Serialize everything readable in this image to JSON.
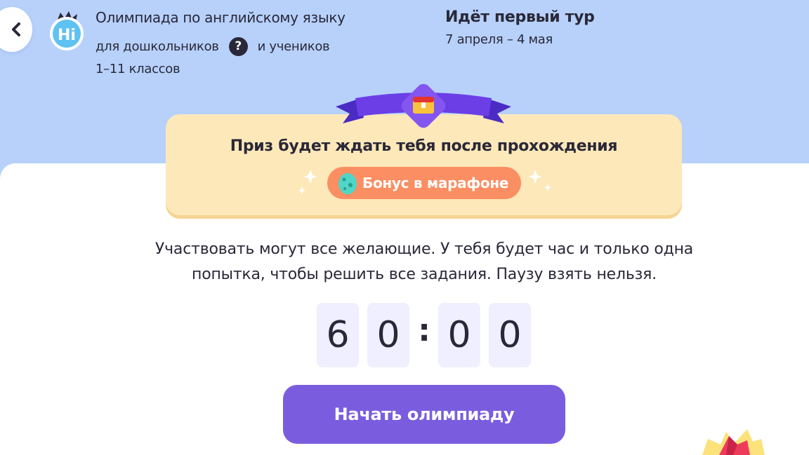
{
  "header": {
    "back_icon": "chevron-left-icon",
    "logo_text": "Hi",
    "title": "Олимпиада по английскому языку",
    "line2_left": "для дошкольников",
    "help_icon_text": "?",
    "line2_right": "и учеников",
    "line3": "1–11 классов",
    "round_title": "Идёт первый тур",
    "round_dates": "7 апреля – 4 мая"
  },
  "prize": {
    "ribbon_icon": "treasure-chest-icon",
    "text": "Приз будет ждать тебя после прохождения",
    "bonus_icon": "egg-icon",
    "bonus_label": "Бонус в марафоне"
  },
  "description": {
    "line1": "Участвовать могут все желающие. У тебя будет час и только одна",
    "line2": "попытка, чтобы решить все задания. Паузу взять нельзя."
  },
  "timer": {
    "digits": [
      "6",
      "0",
      "0",
      "0"
    ],
    "separator": ":"
  },
  "start_button": {
    "label": "Начать олимпиаду"
  },
  "colors": {
    "header_bg": "#b7d1fb",
    "prize_card": "#fde8b9",
    "bonus_button": "#fb8e62",
    "start_button": "#7a5ddf",
    "timer_box": "#efefff",
    "text": "#2a2838"
  }
}
